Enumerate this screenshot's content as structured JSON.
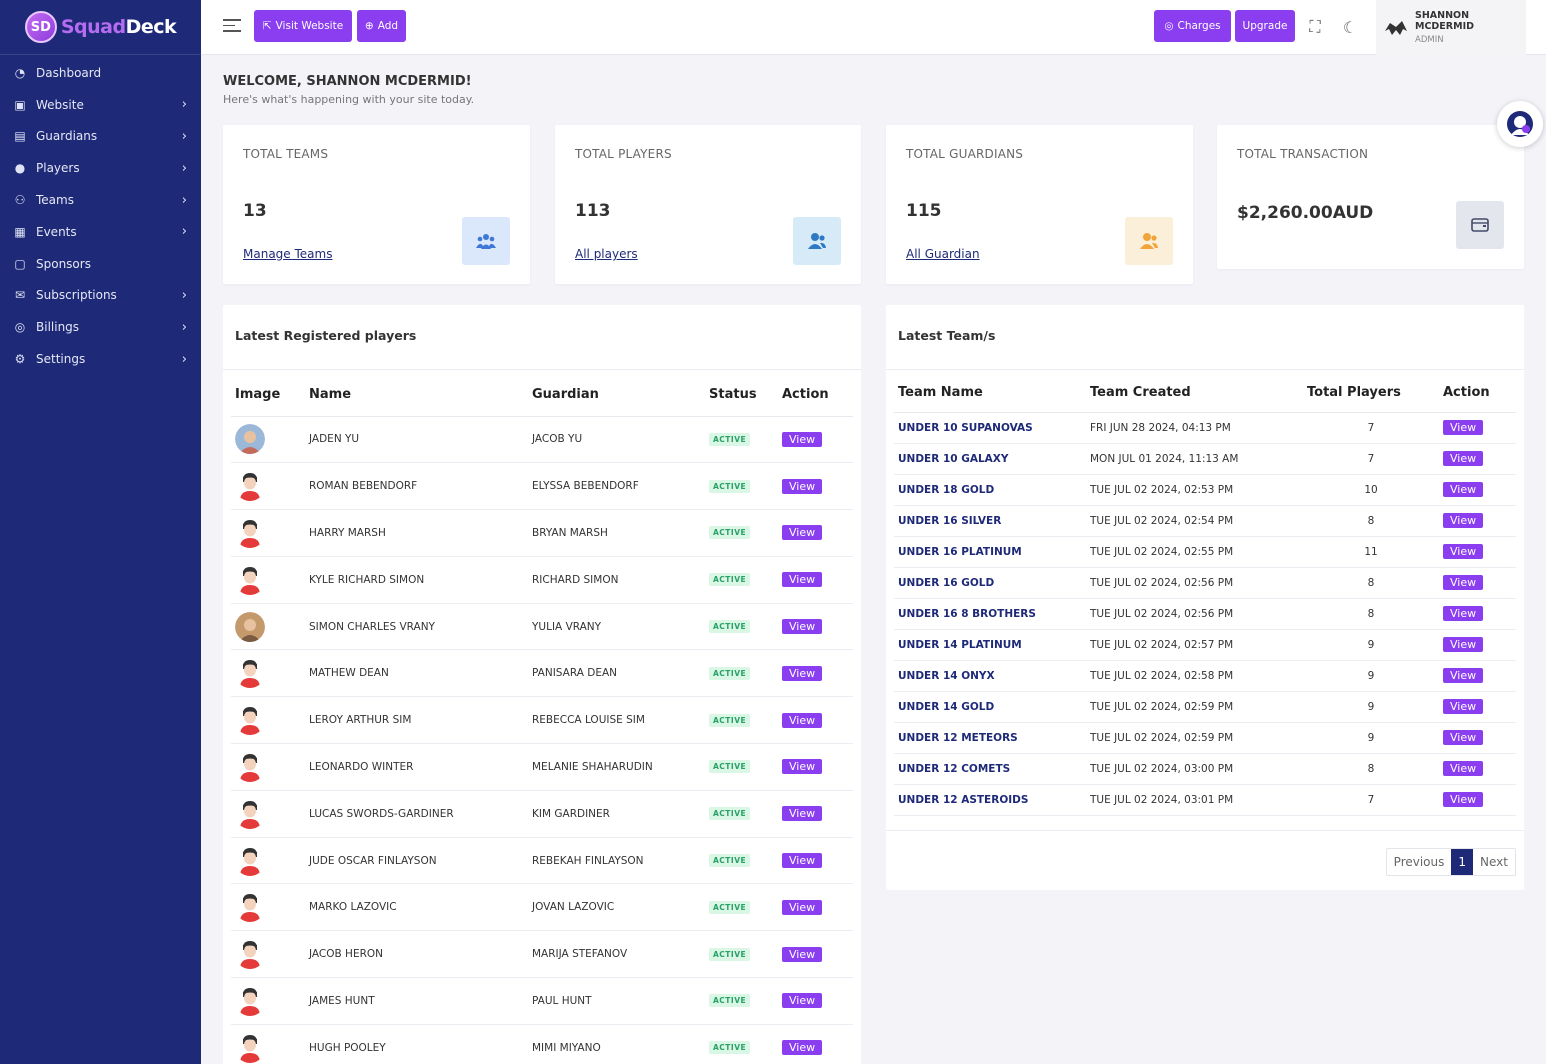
{
  "brand": {
    "part1": "Squad",
    "part2": "Deck",
    "mark": "SD"
  },
  "sidebar": {
    "items": [
      {
        "label": "Dashboard",
        "icon": "dashboard-icon",
        "glyph": "◔",
        "chevron": false
      },
      {
        "label": "Website",
        "icon": "website-icon",
        "glyph": "▣",
        "chevron": true
      },
      {
        "label": "Guardians",
        "icon": "guardians-icon",
        "glyph": "▤",
        "chevron": true
      },
      {
        "label": "Players",
        "icon": "players-icon",
        "glyph": "●",
        "chevron": true
      },
      {
        "label": "Teams",
        "icon": "teams-icon",
        "glyph": "⚇",
        "chevron": true
      },
      {
        "label": "Events",
        "icon": "events-icon",
        "glyph": "▦",
        "chevron": true
      },
      {
        "label": "Sponsors",
        "icon": "sponsors-icon",
        "glyph": "▢",
        "chevron": false
      },
      {
        "label": "Subscriptions",
        "icon": "subscriptions-icon",
        "glyph": "✉",
        "chevron": true
      },
      {
        "label": "Billings",
        "icon": "billings-icon",
        "glyph": "◎",
        "chevron": true
      },
      {
        "label": "Settings",
        "icon": "settings-icon",
        "glyph": "⚙",
        "chevron": true
      }
    ]
  },
  "topbar": {
    "visit_website": "Visit Website",
    "add": "Add",
    "charges": "Charges",
    "upgrade": "Upgrade",
    "user_name": "SHANNON MCDERMID",
    "user_role": "ADMIN"
  },
  "welcome": {
    "title": "WELCOME, SHANNON MCDERMID!",
    "subtitle": "Here's what's happening with your site today."
  },
  "stats": [
    {
      "label": "TOTAL TEAMS",
      "value": "13",
      "link": "Manage Teams"
    },
    {
      "label": "TOTAL PLAYERS",
      "value": "113",
      "link": "All players"
    },
    {
      "label": "TOTAL GUARDIANS",
      "value": "115",
      "link": "All Guardian"
    },
    {
      "label": "TOTAL TRANSACTION",
      "value": "$2,260.00AUD",
      "link": ""
    }
  ],
  "players_card": {
    "title": "Latest Registered players",
    "headers": {
      "image": "Image",
      "name": "Name",
      "guardian": "Guardian",
      "status": "Status",
      "action": "Action"
    },
    "rows": [
      {
        "name": "JADEN YU",
        "guardian": "JACOB YU",
        "status": "ACTIVE",
        "action": "View",
        "photo": true
      },
      {
        "name": "ROMAN BEBENDORF",
        "guardian": "ELYSSA BEBENDORF",
        "status": "ACTIVE",
        "action": "View",
        "photo": false
      },
      {
        "name": "HARRY MARSH",
        "guardian": "BRYAN MARSH",
        "status": "ACTIVE",
        "action": "View",
        "photo": false
      },
      {
        "name": "KYLE RICHARD SIMON",
        "guardian": "RICHARD SIMON",
        "status": "ACTIVE",
        "action": "View",
        "photo": false
      },
      {
        "name": "SIMON CHARLES VRANY",
        "guardian": "YULIA VRANY",
        "status": "ACTIVE",
        "action": "View",
        "photo": true
      },
      {
        "name": "MATHEW DEAN",
        "guardian": "PANISARA DEAN",
        "status": "ACTIVE",
        "action": "View",
        "photo": false
      },
      {
        "name": "LEROY ARTHUR SIM",
        "guardian": "REBECCA LOUISE SIM",
        "status": "ACTIVE",
        "action": "View",
        "photo": false
      },
      {
        "name": "LEONARDO WINTER",
        "guardian": "MELANIE SHAHARUDIN",
        "status": "ACTIVE",
        "action": "View",
        "photo": false
      },
      {
        "name": "LUCAS SWORDS-GARDINER",
        "guardian": "KIM GARDINER",
        "status": "ACTIVE",
        "action": "View",
        "photo": false
      },
      {
        "name": "JUDE OSCAR FINLAYSON",
        "guardian": "REBEKAH FINLAYSON",
        "status": "ACTIVE",
        "action": "View",
        "photo": false
      },
      {
        "name": "MARKO LAZOVIC",
        "guardian": "JOVAN LAZOVIC",
        "status": "ACTIVE",
        "action": "View",
        "photo": false
      },
      {
        "name": "JACOB HERON",
        "guardian": "MARIJA STEFANOV",
        "status": "ACTIVE",
        "action": "View",
        "photo": false
      },
      {
        "name": "JAMES HUNT",
        "guardian": "PAUL HUNT",
        "status": "ACTIVE",
        "action": "View",
        "photo": false
      },
      {
        "name": "HUGH POOLEY",
        "guardian": "MIMI MIYANO",
        "status": "ACTIVE",
        "action": "View",
        "photo": false
      }
    ]
  },
  "teams_card": {
    "title": "Latest Team/s",
    "headers": {
      "team_name": "Team Name",
      "team_created": "Team Created",
      "total_players": "Total Players",
      "action": "Action"
    },
    "rows": [
      {
        "name": "UNDER 10 SUPANOVAS",
        "created": "FRI JUN 28 2024, 04:13 PM",
        "players": "7",
        "action": "View"
      },
      {
        "name": "UNDER 10 GALAXY",
        "created": "MON JUL 01 2024, 11:13 AM",
        "players": "7",
        "action": "View"
      },
      {
        "name": "UNDER 18 GOLD",
        "created": "TUE JUL 02 2024, 02:53 PM",
        "players": "10",
        "action": "View"
      },
      {
        "name": "UNDER 16 SILVER",
        "created": "TUE JUL 02 2024, 02:54 PM",
        "players": "8",
        "action": "View"
      },
      {
        "name": "UNDER 16 PLATINUM",
        "created": "TUE JUL 02 2024, 02:55 PM",
        "players": "11",
        "action": "View"
      },
      {
        "name": "UNDER 16 GOLD",
        "created": "TUE JUL 02 2024, 02:56 PM",
        "players": "8",
        "action": "View"
      },
      {
        "name": "UNDER 16 8 BROTHERS",
        "created": "TUE JUL 02 2024, 02:56 PM",
        "players": "8",
        "action": "View"
      },
      {
        "name": "UNDER 14 PLATINUM",
        "created": "TUE JUL 02 2024, 02:57 PM",
        "players": "9",
        "action": "View"
      },
      {
        "name": "UNDER 14 ONYX",
        "created": "TUE JUL 02 2024, 02:58 PM",
        "players": "9",
        "action": "View"
      },
      {
        "name": "UNDER 14 GOLD",
        "created": "TUE JUL 02 2024, 02:59 PM",
        "players": "9",
        "action": "View"
      },
      {
        "name": "UNDER 12 METEORS",
        "created": "TUE JUL 02 2024, 02:59 PM",
        "players": "9",
        "action": "View"
      },
      {
        "name": "UNDER 12 COMETS",
        "created": "TUE JUL 02 2024, 03:00 PM",
        "players": "8",
        "action": "View"
      },
      {
        "name": "UNDER 12 ASTEROIDS",
        "created": "TUE JUL 02 2024, 03:01 PM",
        "players": "7",
        "action": "View"
      }
    ],
    "pager": {
      "previous": "Previous",
      "current": "1",
      "next": "Next"
    }
  },
  "colors": {
    "sidebar": "#1e2a78",
    "accent": "#8b3df0",
    "active_badge": "#28a068"
  }
}
